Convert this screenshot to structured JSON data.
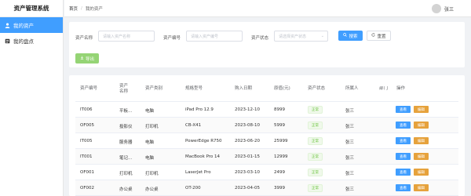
{
  "app": {
    "title": "资产管理系统"
  },
  "sidebar": {
    "items": [
      {
        "label": "我的资产",
        "icon": "user-icon",
        "active": true
      },
      {
        "label": "我的盘点",
        "icon": "list-icon",
        "active": false
      }
    ]
  },
  "header": {
    "breadcrumb": [
      "首页",
      "我的资产"
    ],
    "user": "张三"
  },
  "search": {
    "name_label": "资产名称",
    "name_placeholder": "请输入资产名称",
    "code_label": "资产编号",
    "code_placeholder": "请输入资产编号",
    "status_label": "资产状态",
    "status_placeholder": "请选择资产状态",
    "search_btn": "搜索",
    "reset_btn": "重置",
    "export_btn": "导出"
  },
  "table": {
    "columns": [
      "资产编号",
      "资产名称",
      "资产类别",
      "规格型号",
      "购入日期",
      "原值(元)",
      "资产状态",
      "所属人",
      "部门",
      "操作"
    ],
    "rows": [
      {
        "code": "IT006",
        "name": "平板...",
        "category": "电脑",
        "model": "iPad Pro 12.9",
        "date": "2023-12-10",
        "value": "8999",
        "status": "正常",
        "owner": "张三"
      },
      {
        "code": "OF005",
        "name": "投影仪",
        "category": "打印机",
        "model": "CB-X41",
        "date": "2023-08-10",
        "value": "5999",
        "status": "正常",
        "owner": "张三"
      },
      {
        "code": "IT005",
        "name": "服务器",
        "category": "电脑",
        "model": "PowerEdge R750",
        "date": "2023-06-20",
        "value": "25999",
        "status": "正常",
        "owner": "张三"
      },
      {
        "code": "IT001",
        "name": "笔记...",
        "category": "电脑",
        "model": "MacBook Pro 14",
        "date": "2023-01-15",
        "value": "12999",
        "status": "正常",
        "owner": "张三"
      },
      {
        "code": "OF001",
        "name": "打印机",
        "category": "打印机",
        "model": "LaserJet Pro",
        "date": "2023-03-10",
        "value": "2499",
        "status": "正常",
        "owner": "张三"
      },
      {
        "code": "OF002",
        "name": "办公桌",
        "category": "办公桌",
        "model": "OT-200",
        "date": "2023-04-05",
        "value": "3999",
        "status": "正常",
        "owner": "张三"
      }
    ],
    "view_btn": "查看",
    "edit_btn": "编辑"
  },
  "colors": {
    "primary": "#409eff",
    "success": "#67c23a",
    "warning": "#e6a23c"
  }
}
